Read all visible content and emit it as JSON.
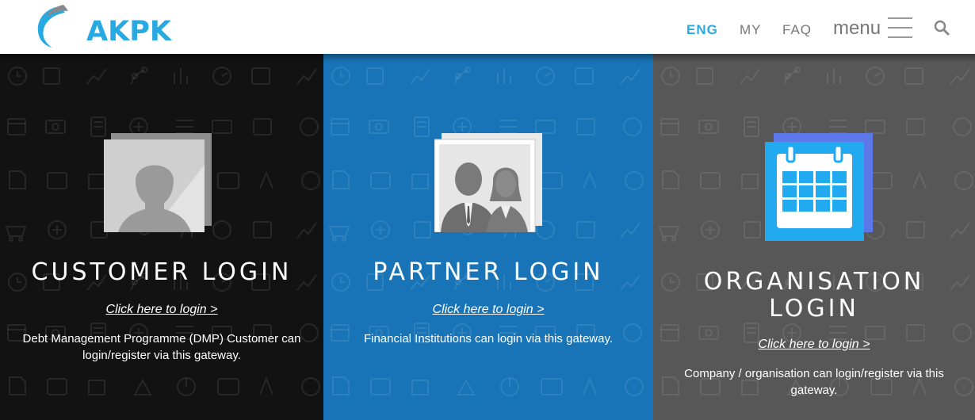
{
  "header": {
    "logo_text": "AKPK",
    "nav": {
      "eng": "ENG",
      "my": "MY",
      "faq": "FAQ",
      "menu": "menu"
    }
  },
  "panels": [
    {
      "title": "CUSTOMER LOGIN",
      "link": "Click here to login >",
      "description": "Debt Management Programme (DMP) Customer can login/register via this gateway.",
      "icon": "person-silhouette-icon",
      "background": "#121212"
    },
    {
      "title": "PARTNER LOGIN",
      "link": "Click here to login >",
      "description": "Financial Institutions can login via this gateway.",
      "icon": "business-people-icon",
      "background": "#1874b6"
    },
    {
      "title_line1": "ORGANISATION",
      "title_line2": "LOGIN",
      "link": "Click here to login >",
      "description": "Company / organisation can login/register via this gateway.",
      "icon": "calendar-icon",
      "background": "#575757"
    }
  ],
  "colors": {
    "accent": "#29a9e1",
    "customer_bg": "#121212",
    "partner_bg": "#1874b6",
    "org_bg": "#575757",
    "calendar_blue": "#21aaf0",
    "calendar_back": "#5b77e8"
  }
}
